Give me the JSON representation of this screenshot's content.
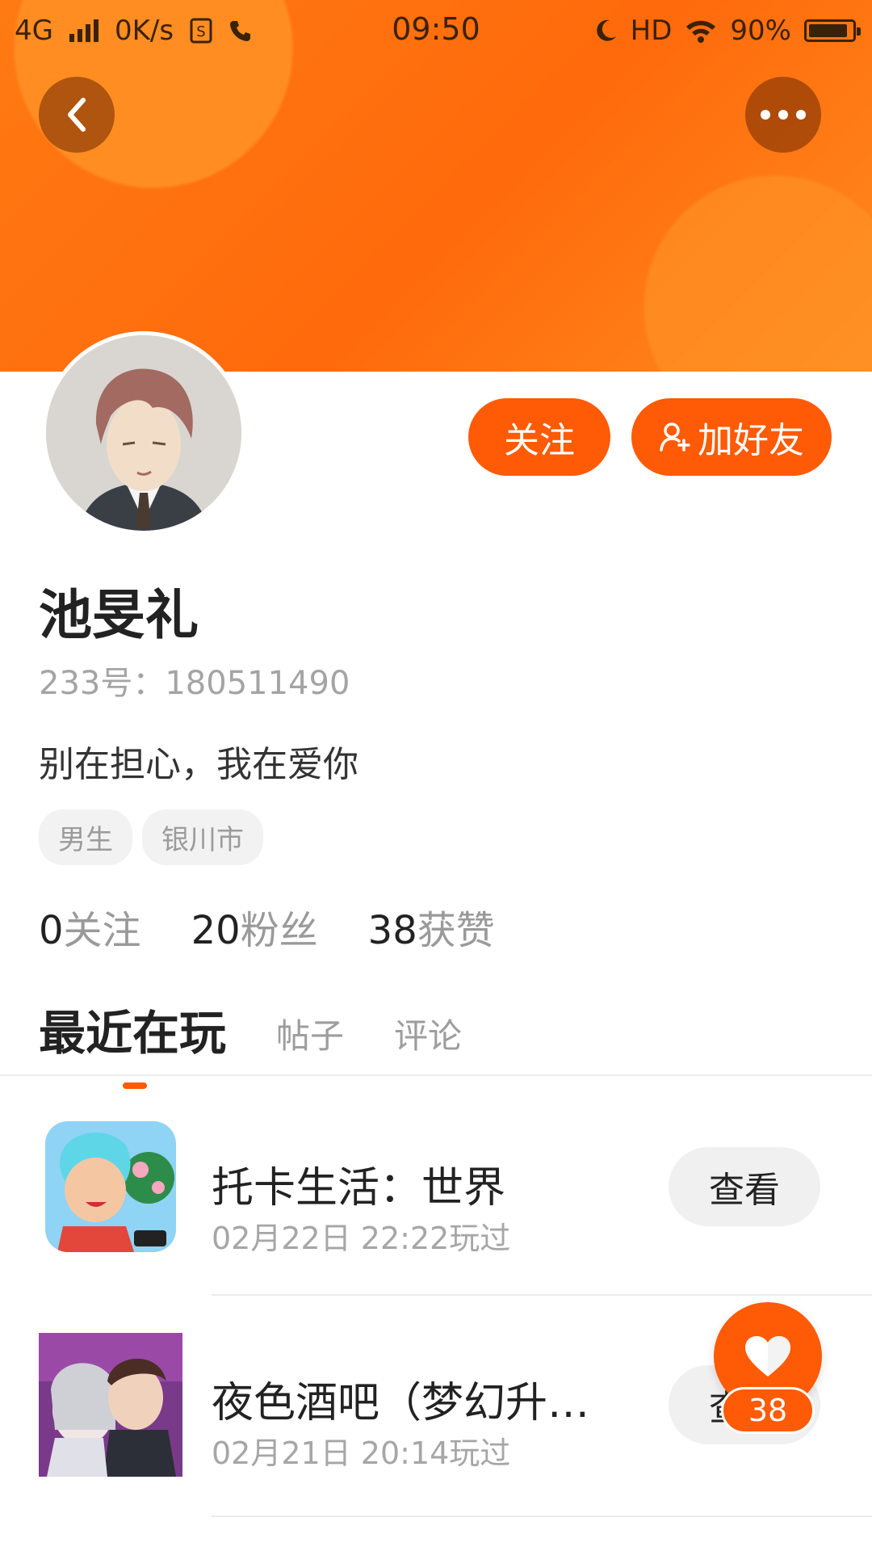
{
  "status_bar": {
    "network": "4G",
    "speed": "0K/s",
    "time": "09:50",
    "hd": "HD",
    "battery": "90%",
    "battery_level": 0.9
  },
  "header": {
    "back_icon": "chevron-left-icon",
    "more_icon": "more-dots-icon"
  },
  "profile": {
    "name": "池旻礼",
    "account_id": "233号：180511490",
    "bio": "别在担心，我在爱你",
    "tags": [
      "男生",
      "银川市"
    ],
    "follow_label": "关注",
    "add_friend_label": "加好友"
  },
  "stats": [
    {
      "num": "0",
      "label": "关注"
    },
    {
      "num": "20",
      "label": "粉丝"
    },
    {
      "num": "38",
      "label": "获赞"
    }
  ],
  "tabs": {
    "active": "最近在玩",
    "items": [
      "帖子",
      "评论"
    ]
  },
  "games": [
    {
      "title": "托卡生活：世界",
      "time": "02月22日 22:22玩过",
      "button": "查看"
    },
    {
      "title": "夜色酒吧（梦幻升…",
      "time": "02月21日 20:14玩过",
      "button": "查看"
    }
  ],
  "like": {
    "count": "38",
    "icon": "heart-icon"
  },
  "colors": {
    "accent": "#ff5a05",
    "header": "#ff7a12"
  }
}
